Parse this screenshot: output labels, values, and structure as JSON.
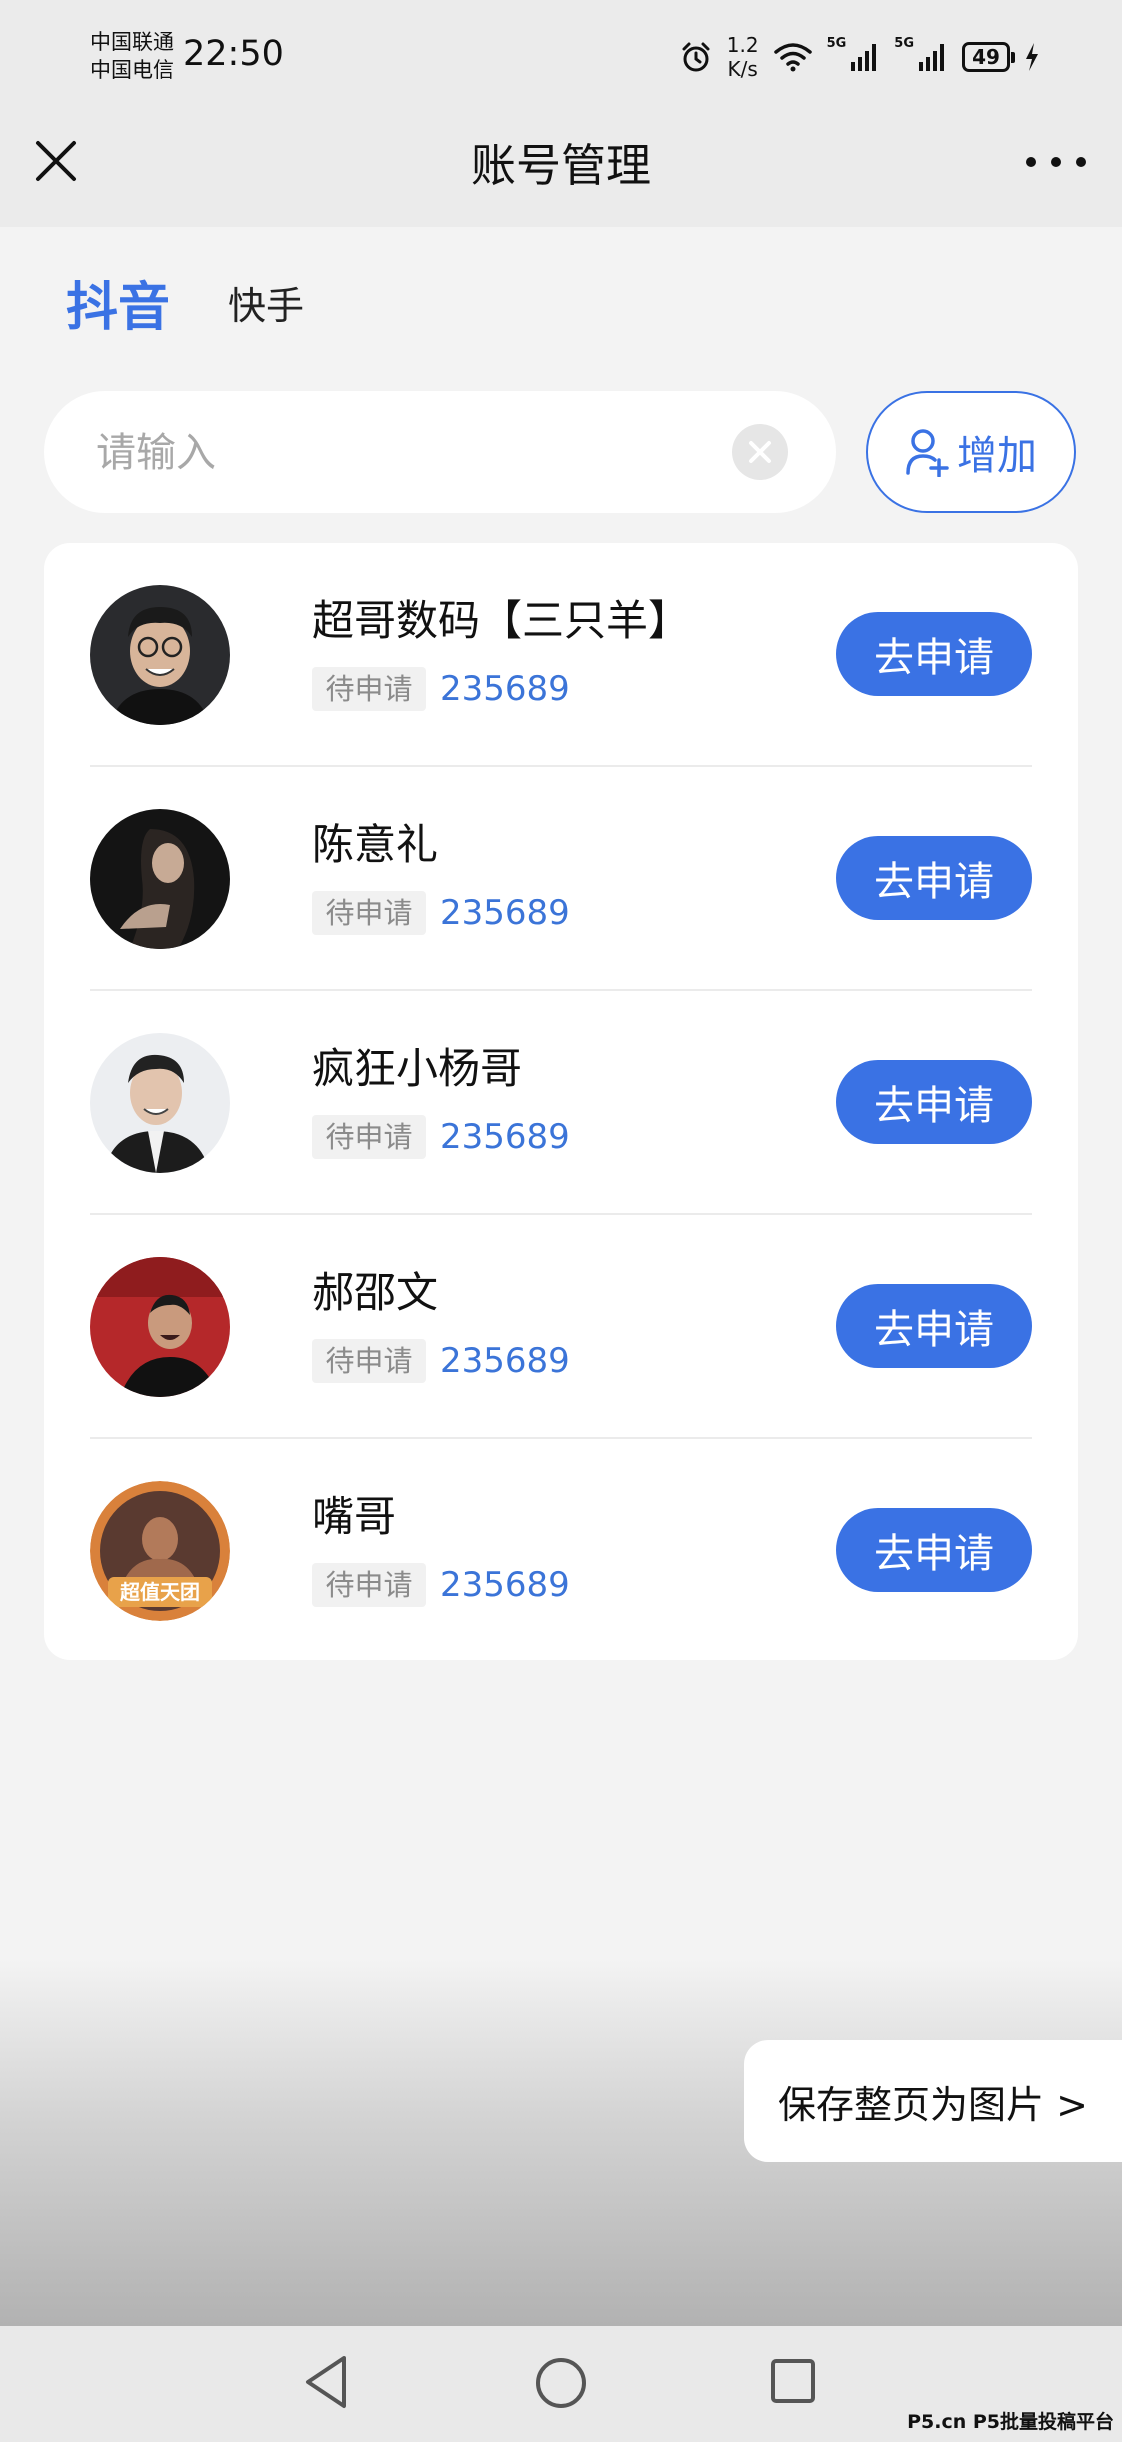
{
  "status_bar": {
    "carrier_1": "中国联通",
    "carrier_2": "中国电信",
    "time": "22:50",
    "net_speed_value": "1.2",
    "net_speed_unit": "K/s",
    "sim1_label": "5G",
    "sim2_label": "5G",
    "battery": "49",
    "icons": [
      "alarm-icon",
      "wifi-icon",
      "signal-icon",
      "battery-icon",
      "charging-icon"
    ]
  },
  "header": {
    "title": "账号管理",
    "close_icon": "close-icon",
    "more_icon": "more-icon"
  },
  "tabs": {
    "active": "抖音",
    "items": [
      "抖音",
      "快手"
    ]
  },
  "search": {
    "placeholder": "请输入",
    "value": ""
  },
  "add_button": {
    "label": "增加",
    "icon": "add-user-icon"
  },
  "accounts": [
    {
      "name": "超哥数码【三只羊】",
      "status": "待申请",
      "code": "235689",
      "action": "去申请"
    },
    {
      "name": "陈意礼",
      "status": "待申请",
      "code": "235689",
      "action": "去申请"
    },
    {
      "name": "疯狂小杨哥",
      "status": "待申请",
      "code": "235689",
      "action": "去申请"
    },
    {
      "name": "郝邵文",
      "status": "待申请",
      "code": "235689",
      "action": "去申请"
    },
    {
      "name": "嘴哥",
      "status": "待申请",
      "code": "235689",
      "action": "去申请",
      "avatar_text": "超值天团"
    }
  ],
  "save_page": {
    "label": "保存整页为图片 >"
  },
  "watermark": "P5.cn P5批量投稿平台",
  "colors": {
    "accent": "#3a72e4",
    "code_text": "#3b74d8",
    "background": "#f3f3f3",
    "card": "#ffffff"
  }
}
